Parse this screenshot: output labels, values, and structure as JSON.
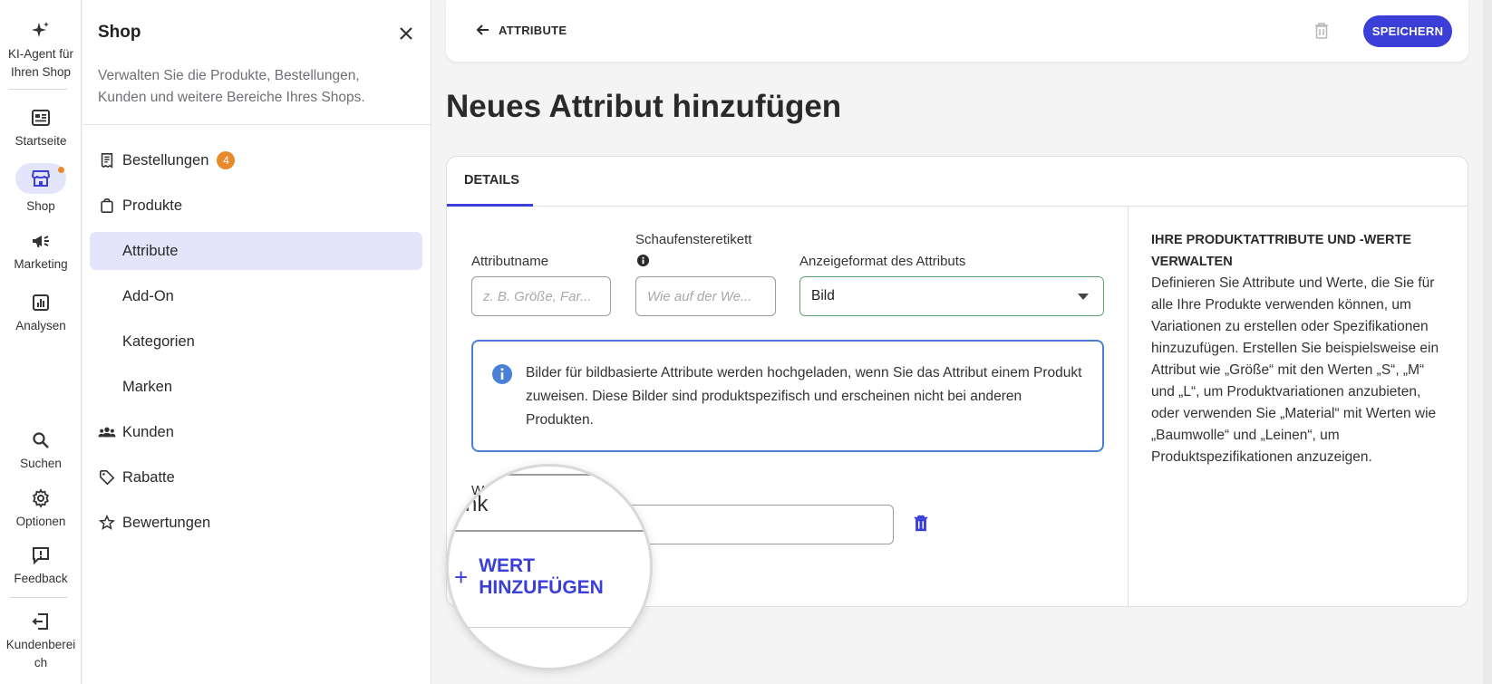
{
  "rail": {
    "items": [
      {
        "label": "KI-Agent für Ihren Shop",
        "icon": "sparkle-icon"
      },
      {
        "label": "Startseite",
        "icon": "dashboard-icon"
      },
      {
        "label": "Shop",
        "icon": "store-icon"
      },
      {
        "label": "Marketing",
        "icon": "megaphone-icon"
      },
      {
        "label": "Analysen",
        "icon": "chart-icon"
      },
      {
        "label": "Suchen",
        "icon": "search-icon"
      },
      {
        "label": "Optionen",
        "icon": "gear-icon"
      },
      {
        "label": "Feedback",
        "icon": "feedback-icon"
      },
      {
        "label": "Kundenbereich",
        "icon": "logout-icon"
      }
    ]
  },
  "panel": {
    "title": "Shop",
    "description": "Verwalten Sie die Produkte, Bestellungen, Kunden und weitere Bereiche Ihres Shops.",
    "nav": [
      {
        "label": "Bestellungen",
        "badge": "4"
      },
      {
        "label": "Produkte"
      },
      {
        "label": "Attribute",
        "active": true
      },
      {
        "label": "Add-On"
      },
      {
        "label": "Kategorien"
      },
      {
        "label": "Marken"
      },
      {
        "label": "Kunden"
      },
      {
        "label": "Rabatte"
      },
      {
        "label": "Bewertungen"
      }
    ]
  },
  "topbar": {
    "back_label": "ATTRIBUTE",
    "save_label": "SPEICHERN"
  },
  "page": {
    "title": "Neues Attribut hinzufügen"
  },
  "details": {
    "tab_label": "DETAILS",
    "attr_name_label": "Attributname",
    "attr_name_placeholder": "z. B. Größe, Far...",
    "storefront_label": "Schaufensteretikett",
    "storefront_placeholder": "Wie auf der We...",
    "format_label": "Anzeigeformat des Attributs",
    "format_value": "Bild",
    "info_text": "Bilder für bildbasierte Attribute werden hochgeladen, wenn Sie das Attribut einem Produkt zuweisen. Diese Bilder sind produktspezifisch und erscheinen nicht bei anderen Produkten.",
    "value_label_partial": "W",
    "value_partial_text": "nk",
    "add_value_label": "WERT HINZUFÜGEN"
  },
  "sidebar_help": {
    "heading": "IHRE PRODUKTATTRIBUTE UND -WERTE VERWALTEN",
    "text": "Definieren Sie Attribute und Werte, die Sie für alle Ihre Produkte verwenden können, um Variationen zu erstellen oder Spezifikationen hinzuzufügen. Erstellen Sie beispielsweise ein Attribut wie „Größe“ mit den Werten „S“, „M“ und „L“, um Produktvariationen anzubieten, oder verwenden Sie „Material“ mit Werten wie „Baumwolle“ und „Leinen“, um Produktspezifikationen anzuzeigen."
  },
  "colors": {
    "accent": "#3b3fd8",
    "badge": "#e88a2c",
    "active_bg": "#e4e4fb",
    "info_border": "#4a7fd6",
    "select_border": "#5aa870"
  }
}
